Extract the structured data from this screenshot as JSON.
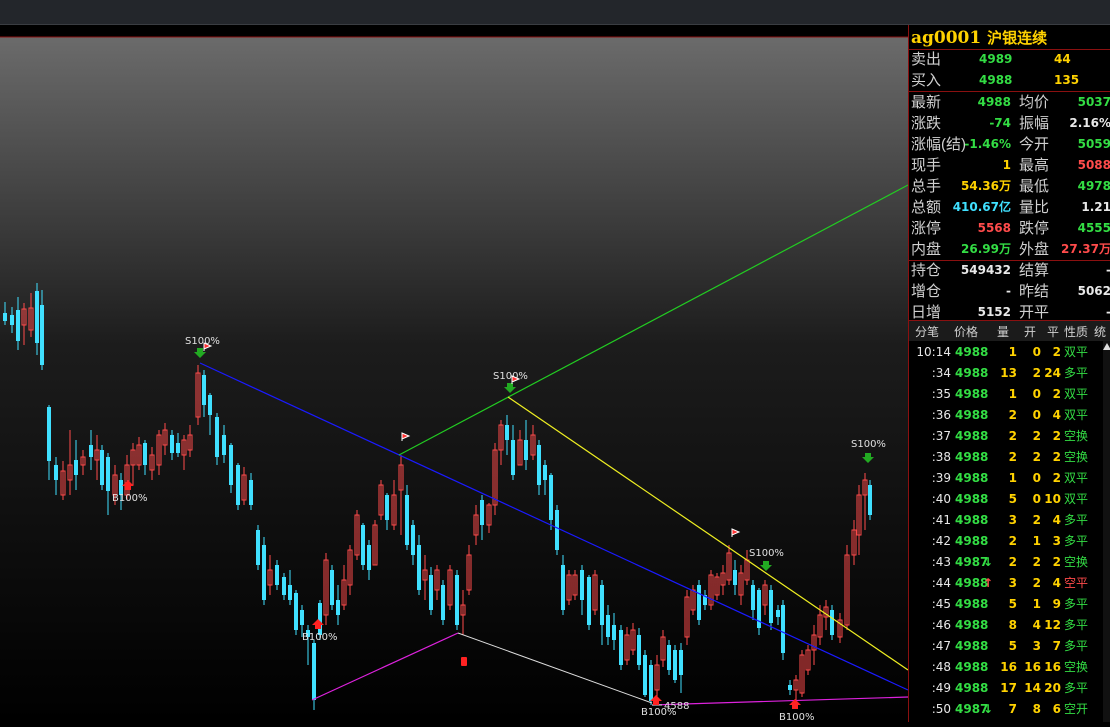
{
  "quote": {
    "code": "ag0001",
    "name": "沪银连续",
    "rows": [
      {
        "label": "卖出",
        "v1": "4989",
        "v1c": "g",
        "v2": "44",
        "v2c": "y"
      },
      {
        "label": "买入",
        "v1": "4988",
        "v1c": "g",
        "v2": "135",
        "v2c": "y"
      }
    ],
    "stats": [
      {
        "l1": "最新",
        "v1": "4988",
        "c1": "g",
        "l2": "均价",
        "v2": "5037",
        "c2": "g"
      },
      {
        "l1": "涨跌",
        "v1": "-74",
        "c1": "g",
        "l2": "振幅",
        "v2": "2.16%",
        "c2": "w"
      },
      {
        "l1": "涨幅(结)",
        "v1": "-1.46%",
        "c1": "g",
        "l2": "今开",
        "v2": "5059",
        "c2": "g"
      },
      {
        "l1": "现手",
        "v1": "1",
        "c1": "y",
        "l2": "最高",
        "v2": "5088",
        "c2": "r"
      },
      {
        "l1": "总手",
        "v1": "54.36万",
        "c1": "y",
        "l2": "最低",
        "v2": "4978",
        "c2": "g"
      },
      {
        "l1": "总额",
        "v1": "410.67亿",
        "c1": "c",
        "l2": "量比",
        "v2": "1.21",
        "c2": "w"
      },
      {
        "l1": "涨停",
        "v1": "5568",
        "c1": "r",
        "l2": "跌停",
        "v2": "4555",
        "c2": "g"
      },
      {
        "l1": "内盘",
        "v1": "26.99万",
        "c1": "g",
        "l2": "外盘",
        "v2": "27.37万",
        "c2": "r"
      },
      {
        "l1": "持仓",
        "v1": "549432",
        "c1": "w",
        "l2": "结算",
        "v2": "-",
        "c2": "w"
      },
      {
        "l1": "增仓",
        "v1": "-",
        "c1": "w",
        "l2": "昨结",
        "v2": "5062",
        "c2": "w"
      },
      {
        "l1": "日增",
        "v1": "5152",
        "c1": "w",
        "l2": "开平",
        "v2": "-",
        "c2": "w"
      }
    ]
  },
  "ticks_header": [
    "分笔",
    "价格",
    "量",
    "开",
    "平",
    "性质",
    "统"
  ],
  "ticks": [
    {
      "time": "10:14",
      "price": "4988",
      "arrow": "",
      "vol": "1",
      "open": "0",
      "close": "2",
      "type": "双平",
      "tc": "g"
    },
    {
      "time": ":34",
      "price": "4988",
      "arrow": "",
      "vol": "13",
      "open": "2",
      "close": "24",
      "type": "多平",
      "tc": "g"
    },
    {
      "time": ":35",
      "price": "4988",
      "arrow": "",
      "vol": "1",
      "open": "0",
      "close": "2",
      "type": "双平",
      "tc": "g"
    },
    {
      "time": ":36",
      "price": "4988",
      "arrow": "",
      "vol": "2",
      "open": "0",
      "close": "4",
      "type": "双平",
      "tc": "g"
    },
    {
      "time": ":37",
      "price": "4988",
      "arrow": "",
      "vol": "2",
      "open": "2",
      "close": "2",
      "type": "空换",
      "tc": "g"
    },
    {
      "time": ":38",
      "price": "4988",
      "arrow": "",
      "vol": "2",
      "open": "2",
      "close": "2",
      "type": "空换",
      "tc": "g"
    },
    {
      "time": ":39",
      "price": "4988",
      "arrow": "",
      "vol": "1",
      "open": "0",
      "close": "2",
      "type": "双平",
      "tc": "g"
    },
    {
      "time": ":40",
      "price": "4988",
      "arrow": "",
      "vol": "5",
      "open": "0",
      "close": "10",
      "type": "双平",
      "tc": "g"
    },
    {
      "time": ":41",
      "price": "4988",
      "arrow": "",
      "vol": "3",
      "open": "2",
      "close": "4",
      "type": "多平",
      "tc": "g"
    },
    {
      "time": ":42",
      "price": "4988",
      "arrow": "",
      "vol": "2",
      "open": "1",
      "close": "3",
      "type": "多平",
      "tc": "g"
    },
    {
      "time": ":43",
      "price": "4987",
      "arrow": "down",
      "vol": "2",
      "open": "2",
      "close": "2",
      "type": "空换",
      "tc": "g"
    },
    {
      "time": ":44",
      "price": "4988",
      "arrow": "up",
      "vol": "3",
      "open": "2",
      "close": "4",
      "type": "空平",
      "tc": "r"
    },
    {
      "time": ":45",
      "price": "4988",
      "arrow": "",
      "vol": "5",
      "open": "1",
      "close": "9",
      "type": "多平",
      "tc": "g"
    },
    {
      "time": ":46",
      "price": "4988",
      "arrow": "",
      "vol": "8",
      "open": "4",
      "close": "12",
      "type": "多平",
      "tc": "g"
    },
    {
      "time": ":47",
      "price": "4988",
      "arrow": "",
      "vol": "5",
      "open": "3",
      "close": "7",
      "type": "多平",
      "tc": "g"
    },
    {
      "time": ":48",
      "price": "4988",
      "arrow": "",
      "vol": "16",
      "open": "16",
      "close": "16",
      "type": "空换",
      "tc": "g"
    },
    {
      "time": ":49",
      "price": "4988",
      "arrow": "",
      "vol": "17",
      "open": "14",
      "close": "20",
      "type": "多平",
      "tc": "g"
    },
    {
      "time": ":50",
      "price": "4987",
      "arrow": "down",
      "vol": "7",
      "open": "8",
      "close": "6",
      "type": "空开",
      "tc": "g"
    }
  ],
  "chart_labels": {
    "s1": "S100%",
    "s2": "S100%",
    "s3": "S100%",
    "s4": "S100%",
    "b1": "B100%",
    "b2": "B100%",
    "b3": "B100%",
    "b4": "B100%",
    "low": "4588"
  },
  "colors": {
    "up": "#ff4b4b",
    "down": "#40e0ff",
    "green": "#33dd44",
    "blue": "#1a1aff",
    "yellow": "#ffee22",
    "magenta": "#dd22dd"
  }
}
